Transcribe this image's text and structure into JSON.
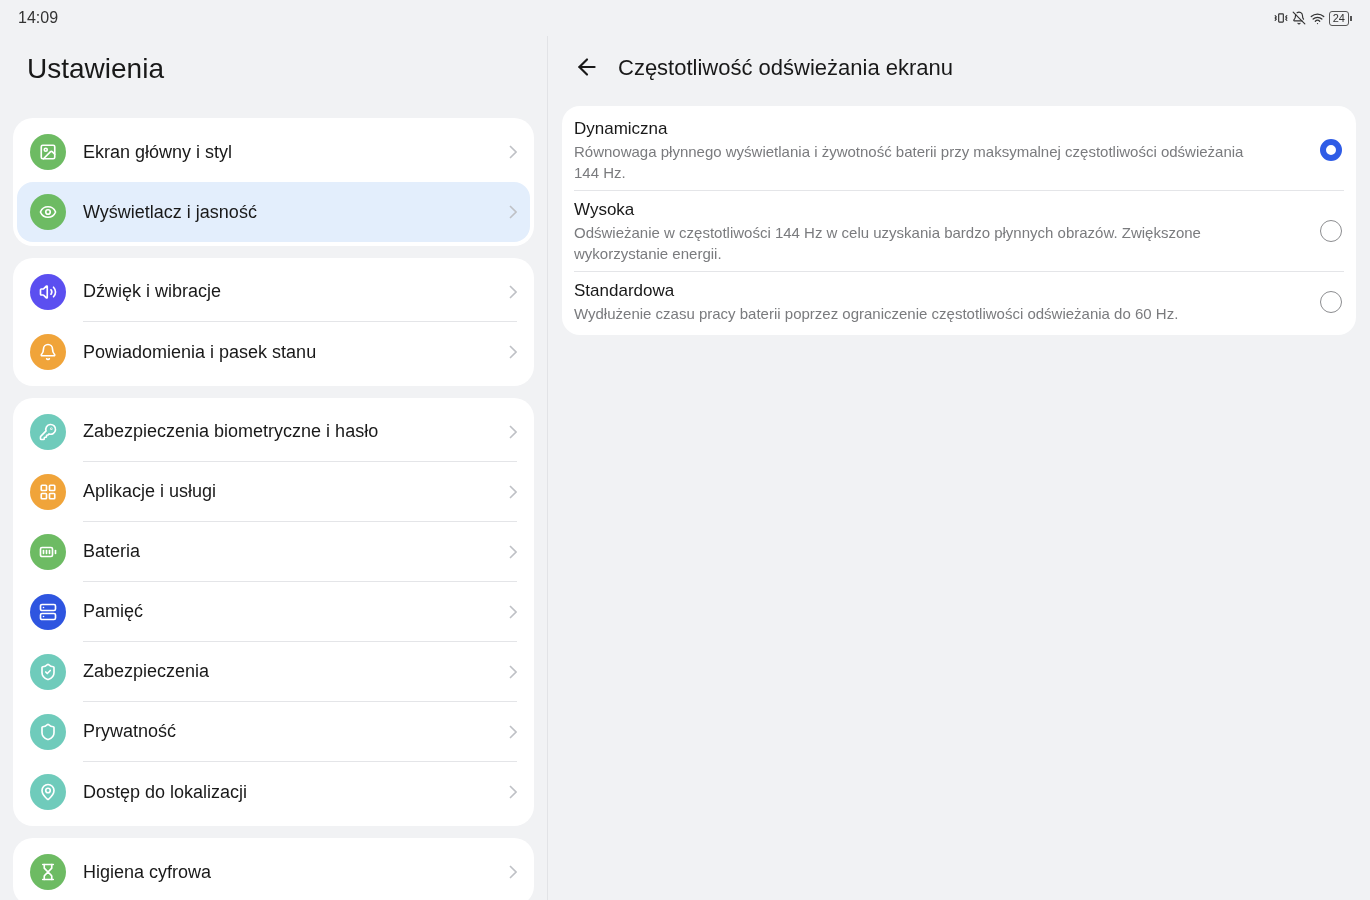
{
  "status_bar": {
    "time": "14:09",
    "battery": "24"
  },
  "sidebar": {
    "title": "Ustawienia",
    "groups": [
      {
        "items": [
          {
            "label": "Ekran główny i styl",
            "kind": "image",
            "color": "#6dbb63",
            "selected": false
          },
          {
            "label": "Wyświetlacz i jasność",
            "kind": "eye",
            "color": "#6dbb63",
            "selected": true
          }
        ]
      },
      {
        "items": [
          {
            "label": "Dźwięk i wibracje",
            "kind": "sound",
            "color": "#5b4ff0",
            "selected": false
          },
          {
            "label": "Powiadomienia i pasek stanu",
            "kind": "bell",
            "color": "#f0a43a",
            "selected": false
          }
        ]
      },
      {
        "items": [
          {
            "label": "Zabezpieczenia biometryczne i hasło",
            "kind": "key",
            "color": "#6fcbbb",
            "selected": false
          },
          {
            "label": "Aplikacje i usługi",
            "kind": "apps",
            "color": "#f0a43a",
            "selected": false
          },
          {
            "label": "Bateria",
            "kind": "battery",
            "color": "#6dbb63",
            "selected": false
          },
          {
            "label": "Pamięć",
            "kind": "storage",
            "color": "#2e55e0",
            "selected": false
          },
          {
            "label": "Zabezpieczenia",
            "kind": "shield",
            "color": "#6fcbbb",
            "selected": false
          },
          {
            "label": "Prywatność",
            "kind": "privacy",
            "color": "#6fcbbb",
            "selected": false
          },
          {
            "label": "Dostęp do lokalizacji",
            "kind": "location",
            "color": "#6fcbbb",
            "selected": false
          }
        ]
      },
      {
        "items": [
          {
            "label": "Higiena cyfrowa",
            "kind": "hourglass",
            "color": "#6dbb63",
            "selected": false
          }
        ]
      }
    ]
  },
  "detail": {
    "title": "Częstotliwość odświeżania ekranu",
    "options": [
      {
        "title": "Dynamiczna",
        "description": "Równowaga płynnego wyświetlania i żywotność baterii przy maksymalnej częstotliwości odświeżania 144 Hz.",
        "selected": true
      },
      {
        "title": "Wysoka",
        "description": "Odświeżanie w częstotliwości 144 Hz w celu uzyskania bardzo płynnych obrazów. Zwiększone wykorzystanie energii.",
        "selected": false
      },
      {
        "title": "Standardowa",
        "description": "Wydłużenie czasu pracy baterii poprzez ograniczenie częstotliwości odświeżania do 60 Hz.",
        "selected": false
      }
    ]
  }
}
